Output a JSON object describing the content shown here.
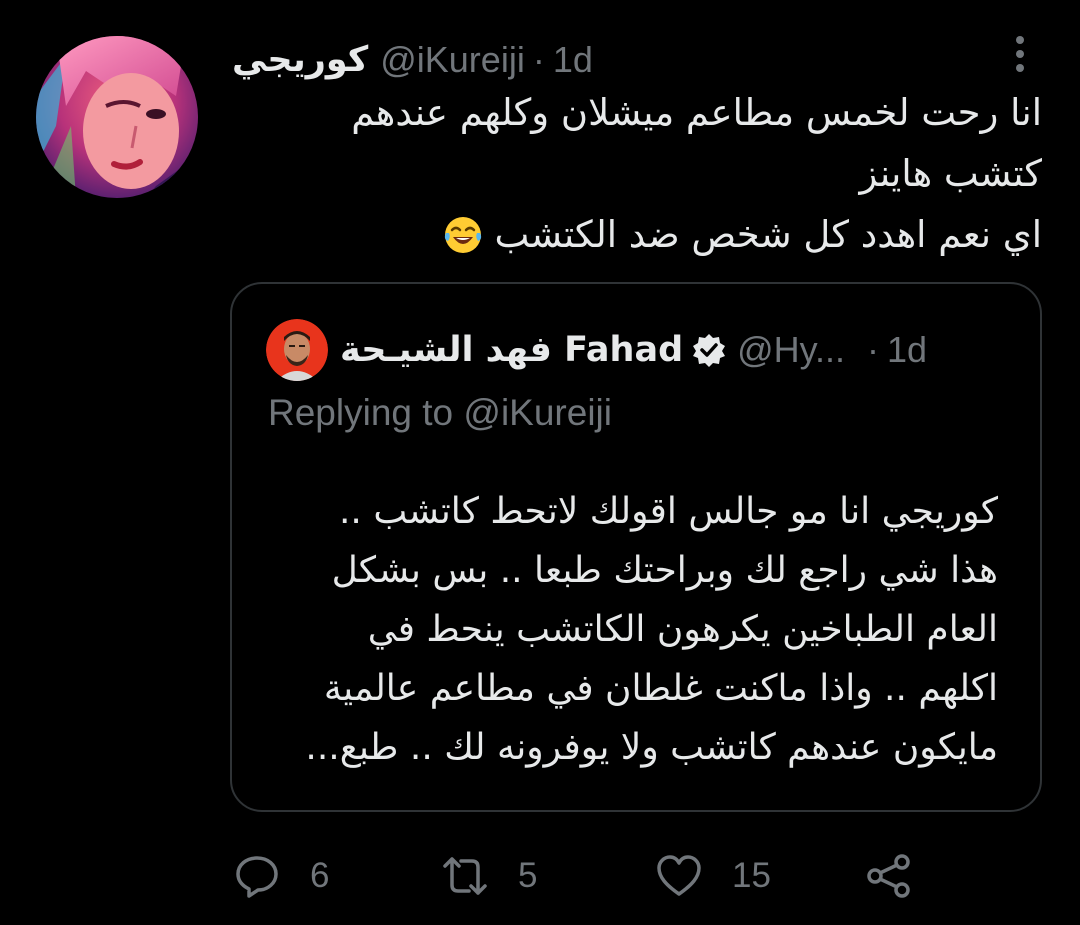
{
  "tweet": {
    "author": {
      "display_name": "كوريجي",
      "handle": "@iKureiji",
      "avatar": "avatar-anime-portrait"
    },
    "separator": "·",
    "time": "1d",
    "more_icon": "more-vertical-icon",
    "text_lines": [
      "انا رحت لخمس مطاعم ميشلان وكلهم عندهم",
      "كتشب هاينز",
      "اي نعم اهدد كل شخص ضد الكتشب"
    ],
    "emoji": "laughing-crying-face"
  },
  "quote": {
    "author": {
      "display_name": "فهد الشيـحة Fahad",
      "handle": "@Hy...",
      "verified": true,
      "avatar": "avatar-man-portrait"
    },
    "separator": "·",
    "time": "1d",
    "replying_label": "Replying to",
    "replying_handle": "@iKureiji",
    "text_lines": [
      "كوريجي انا مو جالس اقولك لاتحط كاتشب ..",
      "هذا شي راجع لك وبراحتك طبعا .. بس بشكل",
      "العام الطباخين يكرهون الكاتشب ينحط في",
      "اكلهم .. واذا ماكنت غلطان في مطاعم عالمية",
      "مايكون عندهم كاتشب ولا يوفرونه لك .. طبع..."
    ]
  },
  "actions": {
    "reply": {
      "icon": "reply-bubble-icon",
      "count": "6"
    },
    "retweet": {
      "icon": "retweet-icon",
      "count": "5"
    },
    "like": {
      "icon": "heart-icon",
      "count": "15"
    },
    "share": {
      "icon": "share-icon"
    }
  },
  "colors": {
    "background": "#000000",
    "text": "#e7e9ea",
    "secondary": "#71767b",
    "border": "#2f3336"
  }
}
